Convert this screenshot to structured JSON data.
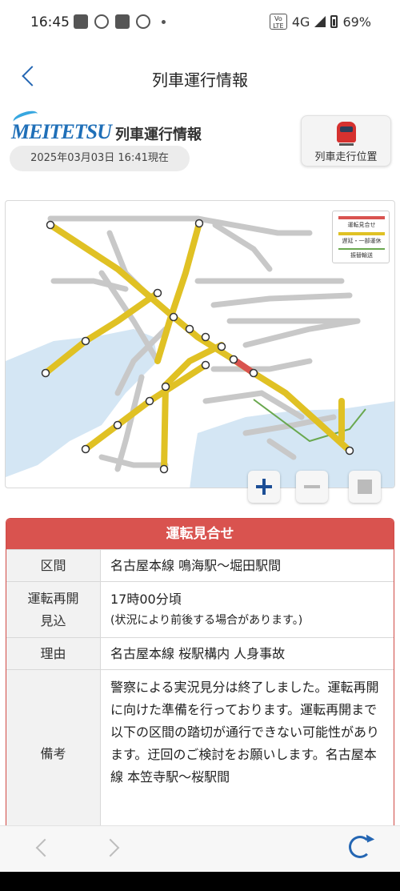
{
  "status_bar": {
    "time": "16:45",
    "volte": "Vo LTE",
    "network": "4G",
    "battery": "69%"
  },
  "header": {
    "title": "列車運行情報"
  },
  "brand": {
    "logo_text": "MEITETSU",
    "title": "列車運行情報",
    "timestamp": "2025年03月03日 16:41現在"
  },
  "position_button": {
    "label": "列車走行位置"
  },
  "map": {
    "legend": {
      "suspended": "運転見合せ",
      "delay": "遅延・一部運休",
      "shuttle": "振替輸送"
    },
    "colors": {
      "normal_line": "#c8c8c8",
      "delay_line": "#e0c124",
      "suspended_line": "#d9534f",
      "shuttle_line": "#6aa84f",
      "water": "#d4e6f4"
    }
  },
  "status": {
    "header": "運転見合せ",
    "rows": [
      {
        "label": "区間",
        "value": "名古屋本線 鳴海駅～堀田駅間"
      },
      {
        "label": "運転再開\n見込",
        "value": "17時00分頃",
        "note": "(状況により前後する場合があります。)"
      },
      {
        "label": "理由",
        "value": "名古屋本線 桜駅構内 人身事故"
      },
      {
        "label": "備考",
        "value": "警察による実況見分は終了しました。運転再開に向けた準備を行っております。運転再開まで以下の区間の踏切が通行できない可能性があります。迂回のご検討をお願いします。名古屋本線 本笠寺駅～桜駅間"
      }
    ],
    "header_color": "#d9534f"
  }
}
